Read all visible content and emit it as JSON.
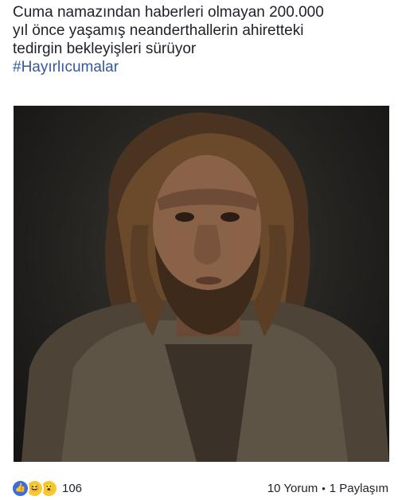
{
  "post": {
    "text_lines": [
      "Cuma namazından haberleri olmayan 200.000",
      "yıl önce yaşamış neanderthallerin ahiretteki",
      "tedirgin bekleyişleri sürüyor"
    ],
    "hashtag": "#Hayırlıcumalar"
  },
  "photo": {
    "subject": "neanderthal-man-portrait"
  },
  "footer": {
    "reactions": [
      "like-icon",
      "haha-icon",
      "wow-icon"
    ],
    "reaction_count": "106",
    "comments": "10 Yorum",
    "separator": "•",
    "shares": "1 Paylaşım"
  },
  "colors": {
    "text": "#1d2129",
    "hashtag": "#365899",
    "like": "#3b6fe0",
    "emoji": "#f7c934"
  }
}
